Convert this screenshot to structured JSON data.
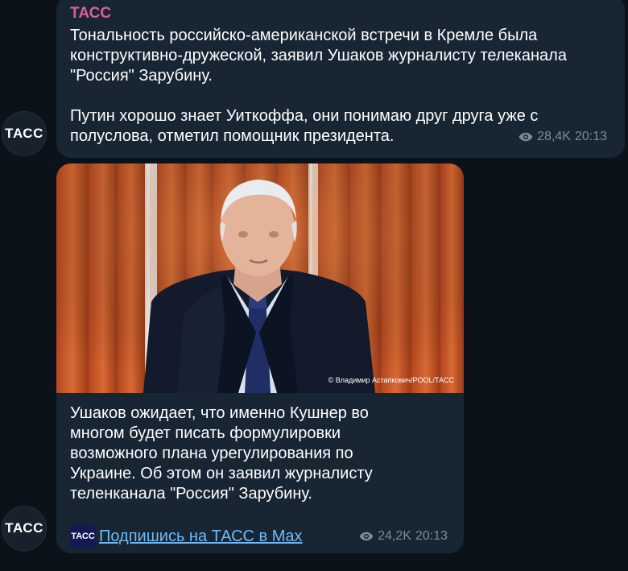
{
  "avatar_label": "ТАСС",
  "messages": [
    {
      "sender": "ТАСС",
      "text": "Тональность российско-американской встречи в Кремле была\nконструктивно-дружеской, заявил Ушаков журналисту телеканала\n\"Россия\" Зарубину.\n\nПутин хорошо знает Уиткоффа, они понимаю друг друга уже с\nполуслова, отметил помощник президента.",
      "views": "28,4K",
      "time": "20:13",
      "icon": "eye-icon"
    },
    {
      "photo_credit": "© Владимир Астапкович/POOL/ТАСС",
      "text": "Ушаков ожидает, что именно Кушнер во\nмногом будет писать формулировки\nвозможного плана урегулирования по\nУкраине. Об этом он заявил журналисту\nтеленканала \"Россия\" Зарубину.",
      "link_logo": "ТАСС",
      "link_text": "Подпишись на ТАСС в Max",
      "views": "24,2K",
      "time": "20:13",
      "icon": "eye-icon"
    }
  ],
  "colors": {
    "background": "#0b1219",
    "bubble": "#182533",
    "sender": "#d36396",
    "link": "#71baf7",
    "meta": "#7d8b99"
  }
}
